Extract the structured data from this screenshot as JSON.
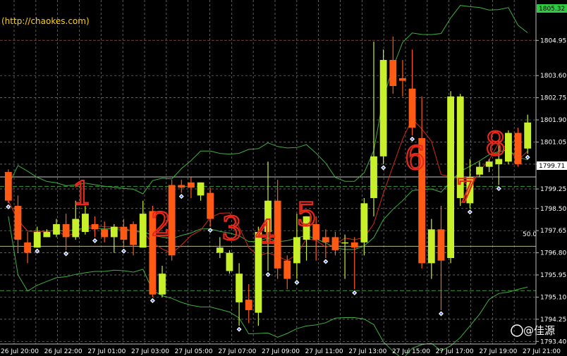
{
  "site_label": "(http://chaokes.com)",
  "watermark": "@佳源",
  "fib_label": "50.0",
  "current_price_label": "1805.32",
  "bid_label": "1799.71",
  "chart_data": {
    "type": "candlestick",
    "ylim": [
      1793.3,
      1806.5
    ],
    "y_ticks": [
      "1804.95",
      "1803.60",
      "1802.75",
      "1801.90",
      "1801.05",
      "1800.20",
      "1799.25",
      "1798.50",
      "1797.65",
      "1796.80",
      "1795.95",
      "1795.10",
      "1794.25",
      "1793.40"
    ],
    "x_ticks": [
      "26 Jul 20:00",
      "26 Jul 22:00",
      "27 Jul 01:00",
      "27 Jul 03:00",
      "27 Jul 05:00",
      "27 Jul 07:00",
      "27 Jul 09:00",
      "27 Jul 11:00",
      "27 Jul 13:00",
      "27 Jul 15:00",
      "27 Jul 17:00",
      "27 Jul 19:00",
      "27 Jul 21:00"
    ],
    "lines": {
      "top_red": 1804.95,
      "fib_50": 1797.05,
      "blue_level": 1799.71,
      "green_dashed": 1795.35,
      "green_solid": 1799.35
    },
    "candles": [
      {
        "o": 1799.9,
        "h": 1800.0,
        "c": 1798.8,
        "l": 1798.7
      },
      {
        "o": 1798.6,
        "h": 1799.0,
        "c": 1797.3,
        "l": 1796.8
      },
      {
        "o": 1797.2,
        "h": 1797.6,
        "c": 1796.8,
        "l": 1796.4
      },
      {
        "o": 1797.0,
        "h": 1797.8,
        "c": 1797.6,
        "l": 1797.0
      },
      {
        "o": 1797.4,
        "h": 1797.7,
        "c": 1797.6,
        "l": 1797.4
      },
      {
        "o": 1797.5,
        "h": 1798.1,
        "c": 1797.9,
        "l": 1797.4
      },
      {
        "o": 1797.9,
        "h": 1798.3,
        "c": 1797.4,
        "l": 1796.9
      },
      {
        "o": 1797.4,
        "h": 1798.8,
        "c": 1798.1,
        "l": 1797.3
      },
      {
        "o": 1797.6,
        "h": 1798.6,
        "c": 1798.3,
        "l": 1797.5
      },
      {
        "o": 1797.9,
        "h": 1798.2,
        "c": 1797.7,
        "l": 1797.4
      },
      {
        "o": 1797.7,
        "h": 1798.0,
        "c": 1797.4,
        "l": 1797.2
      },
      {
        "o": 1797.4,
        "h": 1797.9,
        "c": 1797.8,
        "l": 1796.8
      },
      {
        "o": 1797.8,
        "h": 1798.1,
        "c": 1797.3,
        "l": 1797.0
      },
      {
        "o": 1797.9,
        "h": 1798.0,
        "c": 1797.1,
        "l": 1796.7
      },
      {
        "o": 1797.0,
        "h": 1798.8,
        "c": 1798.3,
        "l": 1797.0
      },
      {
        "o": 1798.4,
        "h": 1798.6,
        "c": 1795.2,
        "l": 1795.1
      },
      {
        "o": 1795.2,
        "h": 1796.3,
        "c": 1796.0,
        "l": 1795.1
      },
      {
        "o": 1799.4,
        "h": 1799.6,
        "c": 1796.7,
        "l": 1796.5
      },
      {
        "o": 1799.4,
        "h": 1799.6,
        "c": 1799.3,
        "l": 1799.1
      },
      {
        "o": 1799.5,
        "h": 1799.7,
        "c": 1799.3,
        "l": 1798.9
      },
      {
        "o": 1799.0,
        "h": 1799.5,
        "c": 1799.5,
        "l": 1798.8
      },
      {
        "o": 1799.1,
        "h": 1799.3,
        "c": 1798.1,
        "l": 1797.8
      },
      {
        "o": 1796.8,
        "h": 1797.4,
        "c": 1797.0,
        "l": 1796.6
      },
      {
        "o": 1796.1,
        "h": 1796.9,
        "c": 1796.8,
        "l": 1796.0
      },
      {
        "o": 1794.9,
        "h": 1796.4,
        "c": 1796.0,
        "l": 1794.0
      },
      {
        "o": 1795.0,
        "h": 1795.6,
        "c": 1794.6,
        "l": 1794.1
      },
      {
        "o": 1794.5,
        "h": 1797.8,
        "c": 1797.6,
        "l": 1794.0
      },
      {
        "o": 1797.6,
        "h": 1800.3,
        "c": 1798.8,
        "l": 1796.1
      },
      {
        "o": 1798.8,
        "h": 1799.6,
        "c": 1796.2,
        "l": 1795.8
      },
      {
        "o": 1796.5,
        "h": 1796.7,
        "c": 1795.8,
        "l": 1795.4
      },
      {
        "o": 1796.4,
        "h": 1798.3,
        "c": 1797.4,
        "l": 1795.8
      },
      {
        "o": 1797.3,
        "h": 1798.2,
        "c": 1798.2,
        "l": 1796.5
      },
      {
        "o": 1797.9,
        "h": 1798.2,
        "c": 1797.3,
        "l": 1796.5
      },
      {
        "o": 1797.4,
        "h": 1797.7,
        "c": 1797.2,
        "l": 1796.6
      },
      {
        "o": 1797.4,
        "h": 1797.6,
        "c": 1796.9,
        "l": 1796.7
      },
      {
        "o": 1797.2,
        "h": 1797.5,
        "c": 1797.2,
        "l": 1795.8
      },
      {
        "o": 1797.2,
        "h": 1797.4,
        "c": 1797.0,
        "l": 1795.4
      },
      {
        "o": 1797.2,
        "h": 1798.9,
        "c": 1798.7,
        "l": 1796.7
      },
      {
        "o": 1798.9,
        "h": 1804.9,
        "c": 1800.5,
        "l": 1798.2
      },
      {
        "o": 1800.5,
        "h": 1804.6,
        "c": 1804.2,
        "l": 1800.2
      },
      {
        "o": 1804.2,
        "h": 1805.1,
        "c": 1803.2,
        "l": 1802.9
      },
      {
        "o": 1803.5,
        "h": 1804.2,
        "c": 1803.4,
        "l": 1802.8
      },
      {
        "o": 1803.1,
        "h": 1804.6,
        "c": 1801.6,
        "l": 1801.3
      },
      {
        "o": 1801.2,
        "h": 1802.8,
        "c": 1796.4,
        "l": 1796.2
      },
      {
        "o": 1796.4,
        "h": 1798.1,
        "c": 1797.7,
        "l": 1795.8
      },
      {
        "o": 1797.7,
        "h": 1798.6,
        "c": 1796.5,
        "l": 1794.6
      },
      {
        "o": 1796.6,
        "h": 1803.0,
        "c": 1802.8,
        "l": 1796.4
      },
      {
        "o": 1798.9,
        "h": 1802.9,
        "c": 1802.8,
        "l": 1798.6
      },
      {
        "o": 1798.7,
        "h": 1800.4,
        "c": 1799.7,
        "l": 1798.5
      },
      {
        "o": 1799.8,
        "h": 1800.3,
        "c": 1800.1,
        "l": 1799.7
      },
      {
        "o": 1800.1,
        "h": 1800.4,
        "c": 1800.3,
        "l": 1799.9
      },
      {
        "o": 1800.2,
        "h": 1801.1,
        "c": 1800.4,
        "l": 1799.4
      },
      {
        "o": 1800.3,
        "h": 1801.5,
        "c": 1801.4,
        "l": 1800.2
      },
      {
        "o": 1801.4,
        "h": 1801.6,
        "c": 1800.2,
        "l": 1800.1
      },
      {
        "o": 1800.8,
        "h": 1802.1,
        "c": 1801.8,
        "l": 1800.6
      }
    ]
  }
}
